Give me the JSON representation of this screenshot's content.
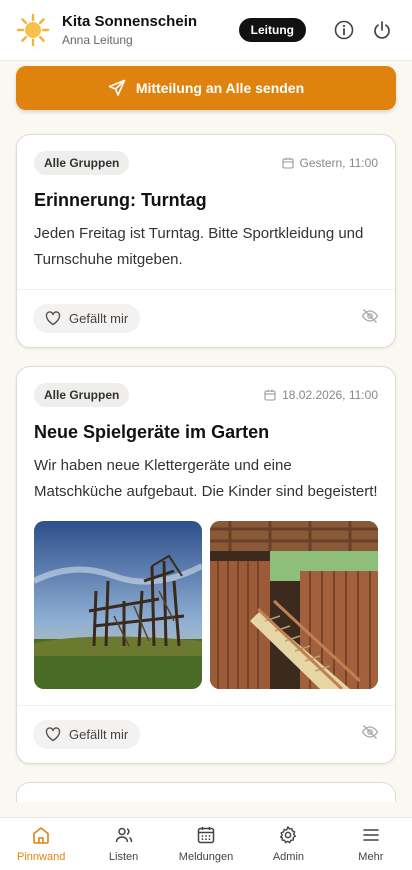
{
  "header": {
    "title": "Kita Sonnenschein",
    "user": "Anna Leitung",
    "role_badge": "Leitung",
    "logo_icon": "sun-icon",
    "info_icon": "info-icon",
    "logout_icon": "power-icon"
  },
  "send_button": {
    "label": "Mitteilung an Alle senden",
    "icon": "send-icon"
  },
  "posts": [
    {
      "group": "Alle Gruppen",
      "date": "Gestern, 11:00",
      "title": "Erinnerung: Turntag",
      "text": "Jeden Freitag ist Turntag. Bitte Sportkleidung und Turnschuhe mitgeben.",
      "like_label": "Gefällt mir"
    },
    {
      "group": "Alle Gruppen",
      "date": "18.02.2026, 11:00",
      "title": "Neue Spielgeräte im Garten",
      "text": "Wir haben neue Klettergeräte und eine Matschküche aufgebaut. Die Kinder sind begeistert!",
      "like_label": "Gefällt mir"
    }
  ],
  "tabs": [
    {
      "label": "Pinnwand",
      "icon": "home-icon",
      "active": true
    },
    {
      "label": "Listen",
      "icon": "users-icon"
    },
    {
      "label": "Meldungen",
      "icon": "calendar-icon"
    },
    {
      "label": "Admin",
      "icon": "gear-icon"
    },
    {
      "label": "Mehr",
      "icon": "menu-icon"
    }
  ],
  "colors": {
    "accent": "#e0830e",
    "background": "#fbf8f2"
  }
}
